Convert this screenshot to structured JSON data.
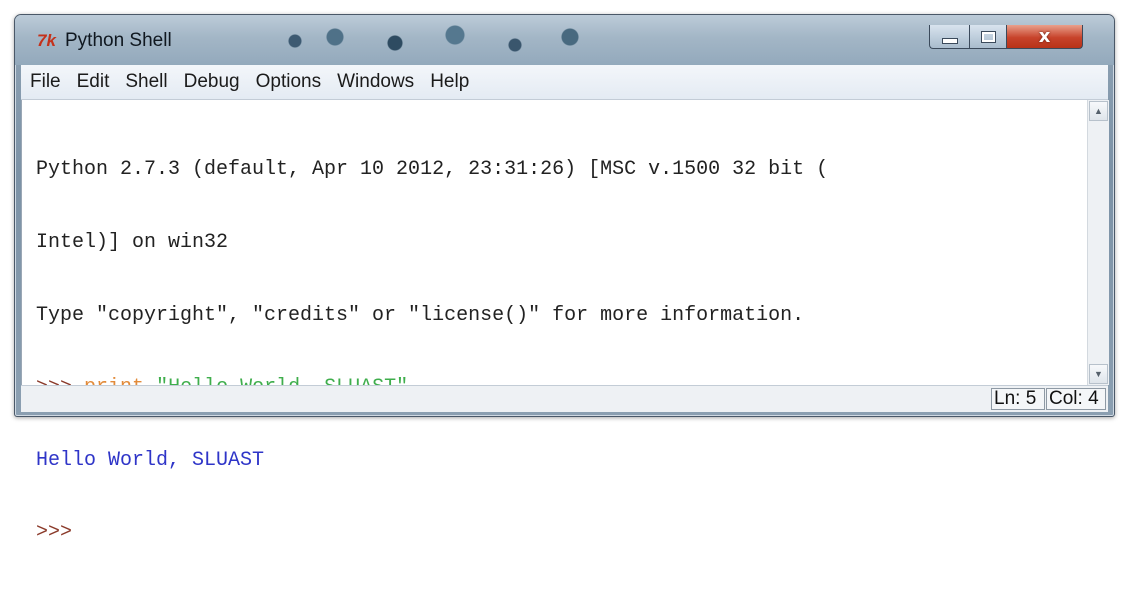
{
  "window": {
    "title": "Python Shell",
    "icon": "idle-tk-icon",
    "icon_glyph": "7k",
    "controls": {
      "minimize": "minimize-icon",
      "maximize": "maximize-icon",
      "close_glyph": "x"
    }
  },
  "menu": [
    "File",
    "Edit",
    "Shell",
    "Debug",
    "Options",
    "Windows",
    "Help"
  ],
  "shell": {
    "banner_line1": "Python 2.7.3 (default, Apr 10 2012, 23:31:26) [MSC v.1500 32 bit (",
    "banner_line2": "Intel)] on win32",
    "banner_line3": "Type \"copyright\", \"credits\" or \"license()\" for more information.",
    "prompt": ">>>",
    "keyword": "print",
    "string": "\"Hello World, SLUAST\"",
    "output": "Hello World, SLUAST",
    "prompt2": ">>>"
  },
  "colors": {
    "prompt": "#8b3a2a",
    "keyword": "#e28b3a",
    "string": "#3fae4c",
    "output": "#2f35c8"
  },
  "status": {
    "line": "Ln: 5",
    "col": "Col: 4"
  }
}
